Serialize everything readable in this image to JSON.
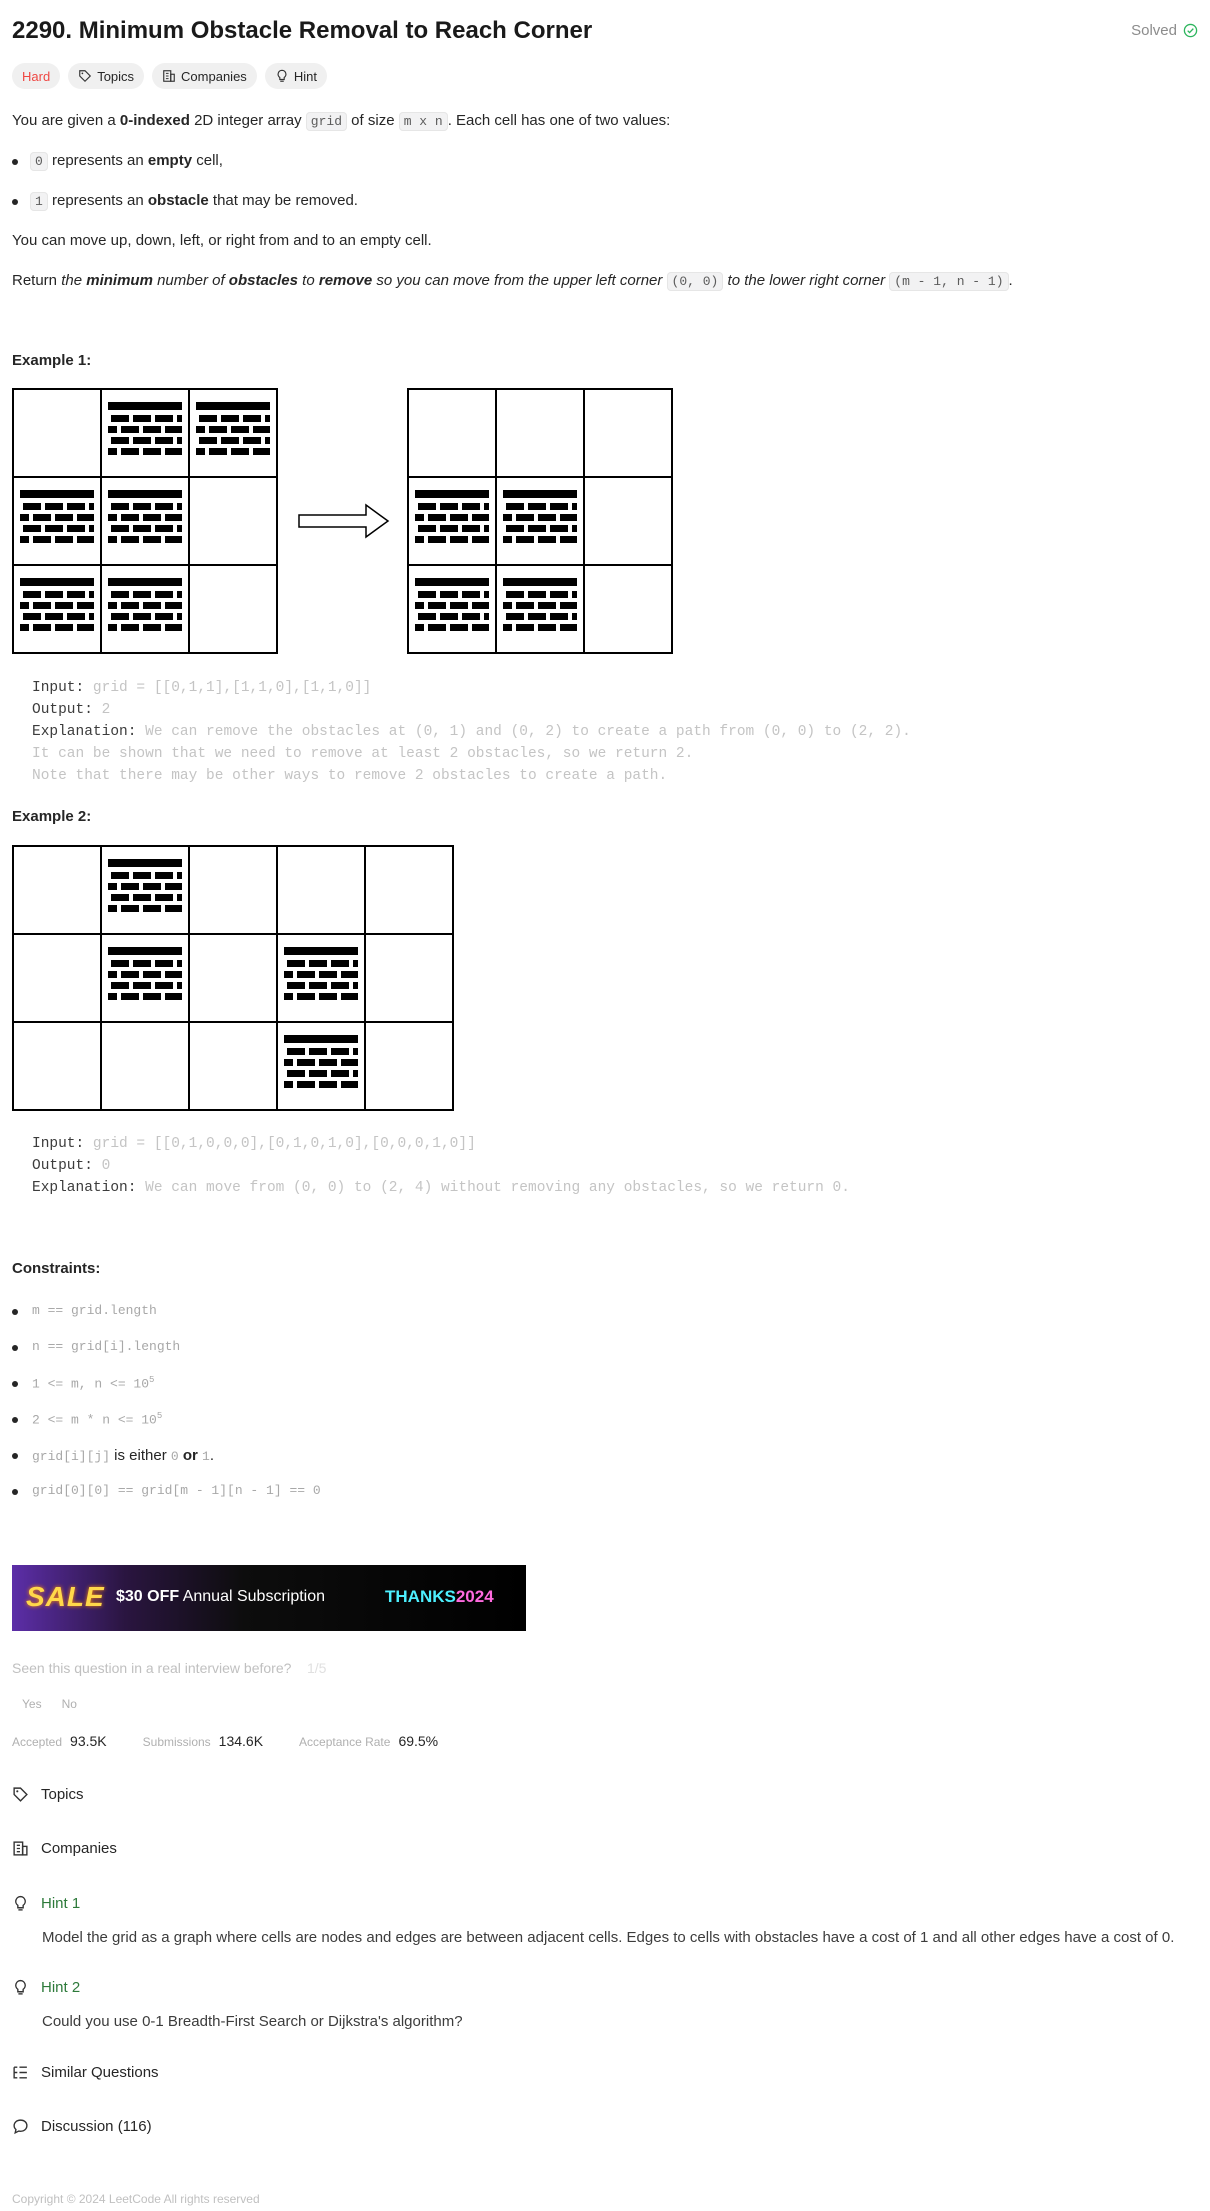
{
  "problem": {
    "title": "2290. Minimum Obstacle Removal to Reach Corner",
    "solved_label": "Solved",
    "difficulty": "Hard",
    "tags": {
      "topics": "Topics",
      "companies": "Companies",
      "hint": "Hint"
    }
  },
  "description": {
    "p1_a": "You are given a ",
    "p1_b": "0-indexed",
    "p1_c": " 2D integer array ",
    "p1_code1": "grid",
    "p1_d": " of size ",
    "p1_code2": "m x n",
    "p1_e": ". Each cell has one of two values:",
    "b1_code": "0",
    "b1_a": " represents an ",
    "b1_b": "empty",
    "b1_c": " cell,",
    "b2_code": "1",
    "b2_a": " represents an ",
    "b2_b": "obstacle",
    "b2_c": " that may be removed.",
    "p2": "You can move up, down, left, or right from and to an empty cell.",
    "p3_a": "Return ",
    "p3_b": "the ",
    "p3_c": "minimum",
    "p3_d": " number of ",
    "p3_e": "obstacles",
    "p3_f": " to ",
    "p3_g": "remove",
    "p3_h": " so you can move from the upper left corner ",
    "p3_code1": "(0, 0)",
    "p3_i": " to the lower right corner ",
    "p3_code2": "(m - 1, n - 1)",
    "p3_j": "."
  },
  "examples": [
    {
      "heading": "Example 1:",
      "input_label": "Input:",
      "input_value": "grid = [[0,1,1],[1,1,0],[1,1,0]]",
      "output_label": "Output:",
      "output_value": "2",
      "explanation_label": "Explanation:",
      "explanation_value": "We can remove the obstacles at (0, 1) and (0, 2) to create a path from (0, 0) to (2, 2).",
      "explanation_line2": "It can be shown that we need to remove at least 2 obstacles, so we return 2.",
      "explanation_line3": "Note that there may be other ways to remove 2 obstacles to create a path."
    },
    {
      "heading": "Example 2:",
      "input_label": "Input:",
      "input_value": "grid = [[0,1,0,0,0],[0,1,0,1,0],[0,0,0,1,0]]",
      "output_label": "Output:",
      "output_value": "0",
      "explanation_label": "Explanation:",
      "explanation_value": "We can move from (0, 0) to (2, 4) without removing any obstacles, so we return 0."
    }
  ],
  "constraints": {
    "heading": "Constraints:",
    "c1": "m == grid.length",
    "c2": "n == grid[i].length",
    "c3_a": "1 <= m, n <= 10",
    "c3_sup": "5",
    "c4_a": "2 <= m * n <= 10",
    "c4_sup": "5",
    "c5_code": "grid[i][j]",
    "c5_a": " is either ",
    "c5_code2": "0",
    "c5_b": " or ",
    "c5_code3": "1",
    "c5_c": ".",
    "c6": "grid[0][0] == grid[m - 1][n - 1] == 0"
  },
  "banner": {
    "sale": "SALE",
    "amount": "$30 OFF",
    "text": " Annual Subscription",
    "code_a": "THANKS",
    "code_b": "2024"
  },
  "interview": {
    "question": "Seen this question in a real interview before?",
    "fraction": "1/5",
    "yes": "Yes",
    "no": "No"
  },
  "stats": {
    "accepted_label": "Accepted",
    "accepted_value": "93.5K",
    "submissions_label": "Submissions",
    "submissions_value": "134.6K",
    "rate_label": "Acceptance Rate",
    "rate_value": "69.5%"
  },
  "sections": {
    "topics": "Topics",
    "companies": "Companies",
    "hint1": "Hint 1",
    "hint1_body": "Model the grid as a graph where cells are nodes and edges are between adjacent cells. Edges to cells with obstacles have a cost of 1 and all other edges have a cost of 0.",
    "hint2": "Hint 2",
    "hint2_body": "Could you use 0-1 Breadth-First Search or Dijkstra's algorithm?",
    "similar": "Similar Questions",
    "discussion": "Discussion (116)"
  },
  "footer": "Copyright © 2024 LeetCode All rights reserved",
  "colors": {
    "hard": "#ef4743",
    "hint_green": "#2d7a3a",
    "solved_check": "#2db55d"
  }
}
